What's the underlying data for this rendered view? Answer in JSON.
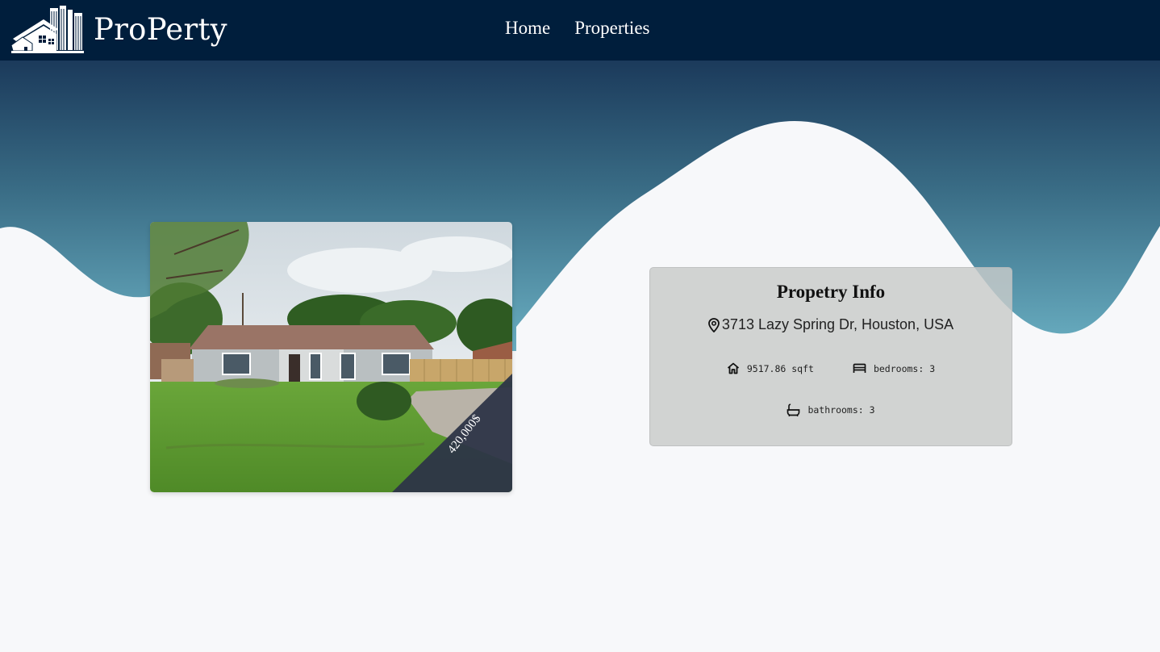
{
  "header": {
    "brand_name": "ProPerty",
    "logo_icon": "houses-buildings-logo",
    "nav": [
      {
        "label": "Home"
      },
      {
        "label": "Properties"
      }
    ]
  },
  "colors": {
    "navbar_bg": "#001e3c",
    "wave_top": "#1b3d5e",
    "wave_bottom": "#66aabb",
    "page_bg": "#f7f8fa",
    "ribbon_bg": "#2d3547",
    "card_bg": "#c8cac9"
  },
  "listing": {
    "price": "420,000$",
    "image_alt": "house-photo",
    "info": {
      "title": "Propetry Info",
      "address": "3713 Lazy Spring Dr, Houston, USA",
      "address_icon": "map-pin-icon",
      "area": "9517.86 sqft",
      "area_icon": "home-icon",
      "bedrooms": "bedrooms: 3",
      "bedrooms_icon": "bed-icon",
      "bathrooms": "bathrooms: 3",
      "bathrooms_icon": "bathtub-icon"
    }
  }
}
